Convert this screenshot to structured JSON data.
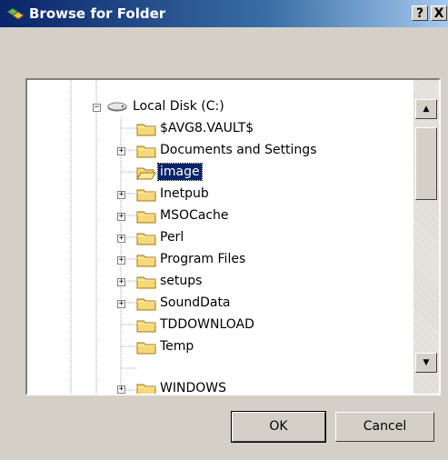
{
  "window": {
    "title": "Browse for Folder",
    "help_label": "?",
    "close_label": "X"
  },
  "tree": {
    "items": [
      {
        "label": "Local Disk (C:)",
        "icon": "drive-icon",
        "expander": "minus"
      },
      {
        "label": "$AVG8.VAULT$",
        "icon": "folder-icon",
        "expander": "none"
      },
      {
        "label": "Documents and Settings",
        "icon": "folder-icon",
        "expander": "plus"
      },
      {
        "label": "image",
        "icon": "folder-open-icon",
        "expander": "none",
        "selected": true
      },
      {
        "label": "Inetpub",
        "icon": "folder-icon",
        "expander": "plus"
      },
      {
        "label": "MSOCache",
        "icon": "folder-icon",
        "expander": "plus"
      },
      {
        "label": "Perl",
        "icon": "folder-icon",
        "expander": "plus"
      },
      {
        "label": "Program Files",
        "icon": "folder-icon",
        "expander": "plus"
      },
      {
        "label": "setups",
        "icon": "folder-icon",
        "expander": "plus"
      },
      {
        "label": "SoundData",
        "icon": "folder-icon",
        "expander": "plus"
      },
      {
        "label": "TDDOWNLOAD",
        "icon": "folder-icon",
        "expander": "none"
      },
      {
        "label": "Temp",
        "icon": "folder-icon",
        "expander": "none"
      },
      {
        "label": "WINDOWS",
        "icon": "folder-icon",
        "expander": "plus"
      }
    ]
  },
  "scrollbar": {
    "up_arrow": "▲",
    "down_arrow": "▼"
  },
  "buttons": {
    "ok": "OK",
    "cancel": "Cancel"
  },
  "colors": {
    "selection": "#0a246a",
    "folder_yellow": "#f5d878",
    "title_bar": "#0a246a"
  }
}
